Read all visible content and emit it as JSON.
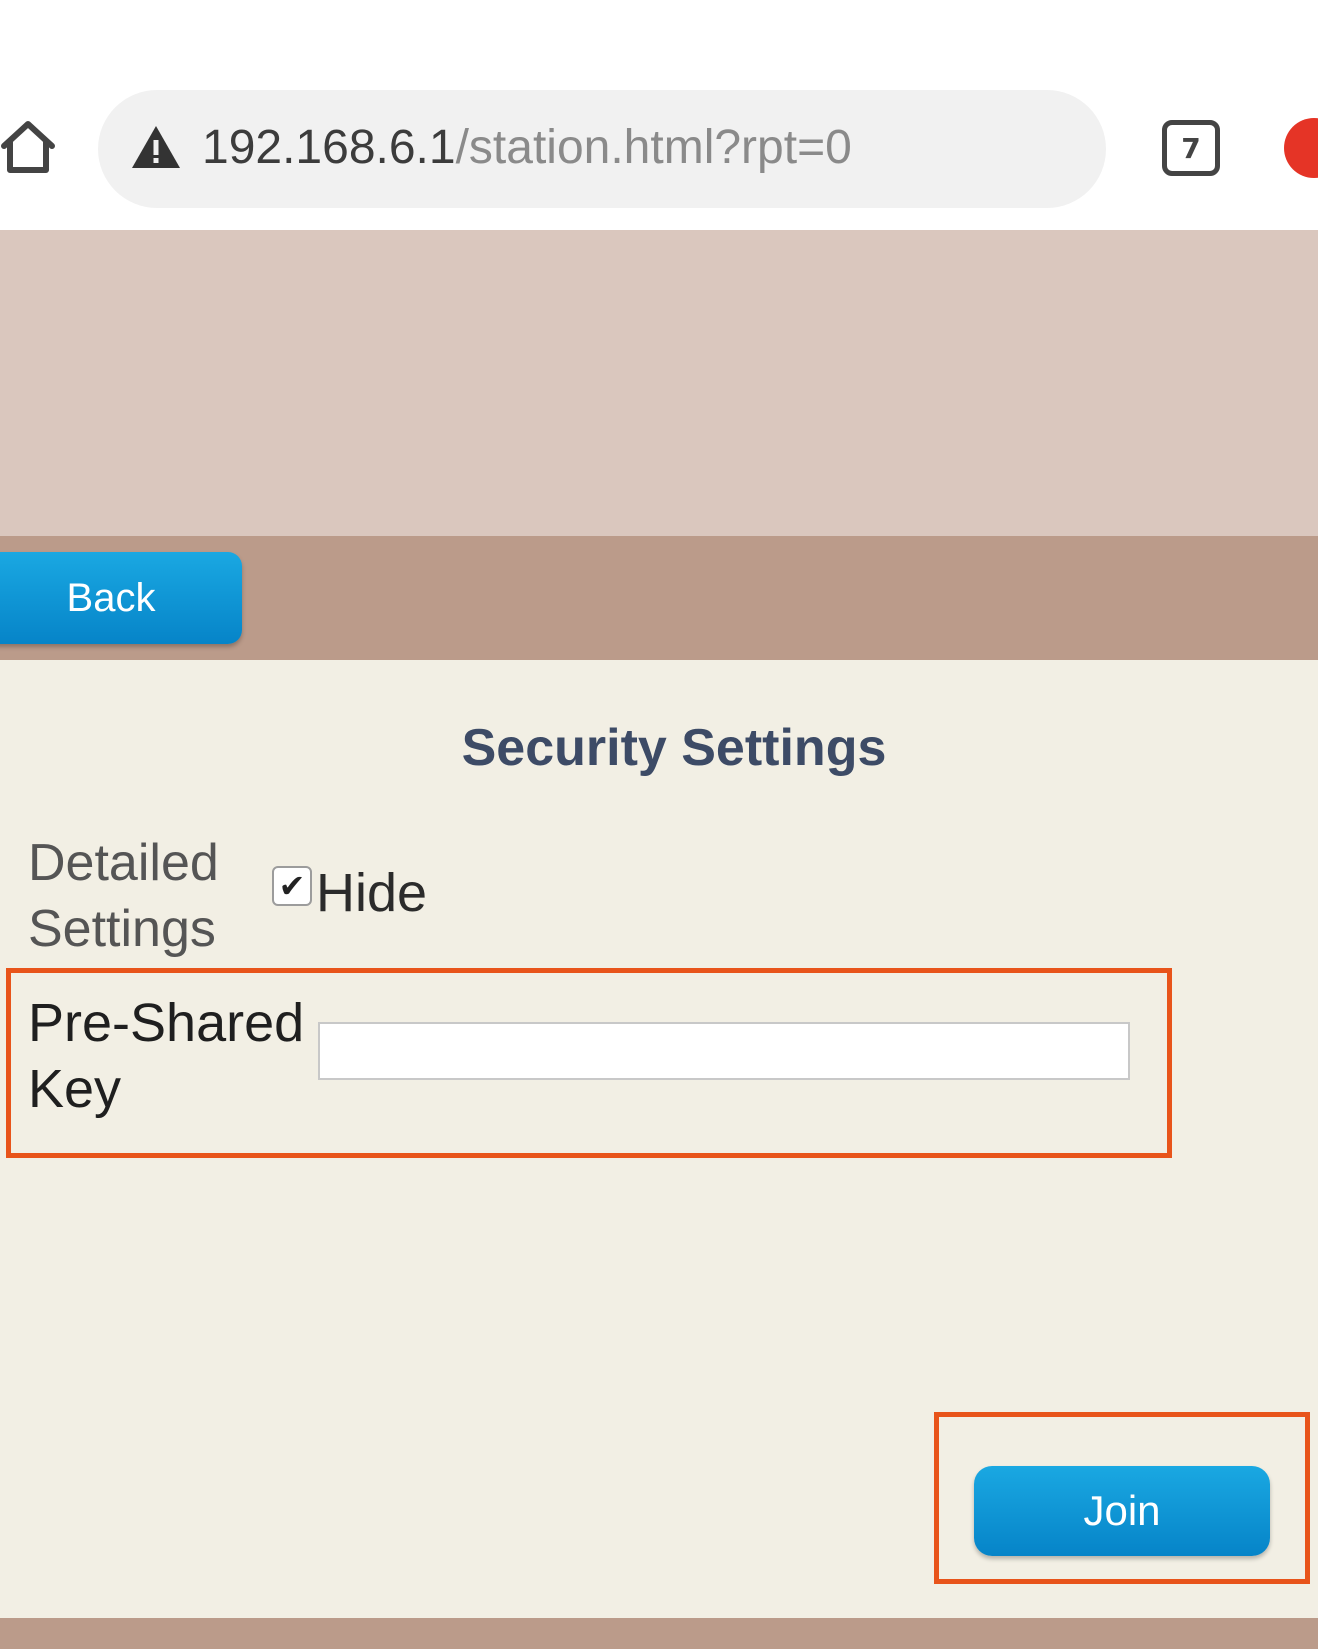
{
  "browser": {
    "url_host": "192.168.6.1",
    "url_path": "/station.html?rpt=0",
    "tabs_count": "7"
  },
  "nav": {
    "back_label": "Back"
  },
  "page": {
    "title": "Security Settings"
  },
  "form": {
    "detailed_settings_label": "Detailed Settings",
    "hide_label": "Hide",
    "hide_checked": true,
    "psk_label": "Pre-Shared Key",
    "psk_value": "",
    "join_label": "Join"
  },
  "colors": {
    "button_blue": "#0b93d6",
    "header_band": "#dac7be",
    "nav_band": "#bb9b8a",
    "page_bg": "#f2efe4",
    "highlight": "#e8541a",
    "title_color": "#3d4b66"
  }
}
